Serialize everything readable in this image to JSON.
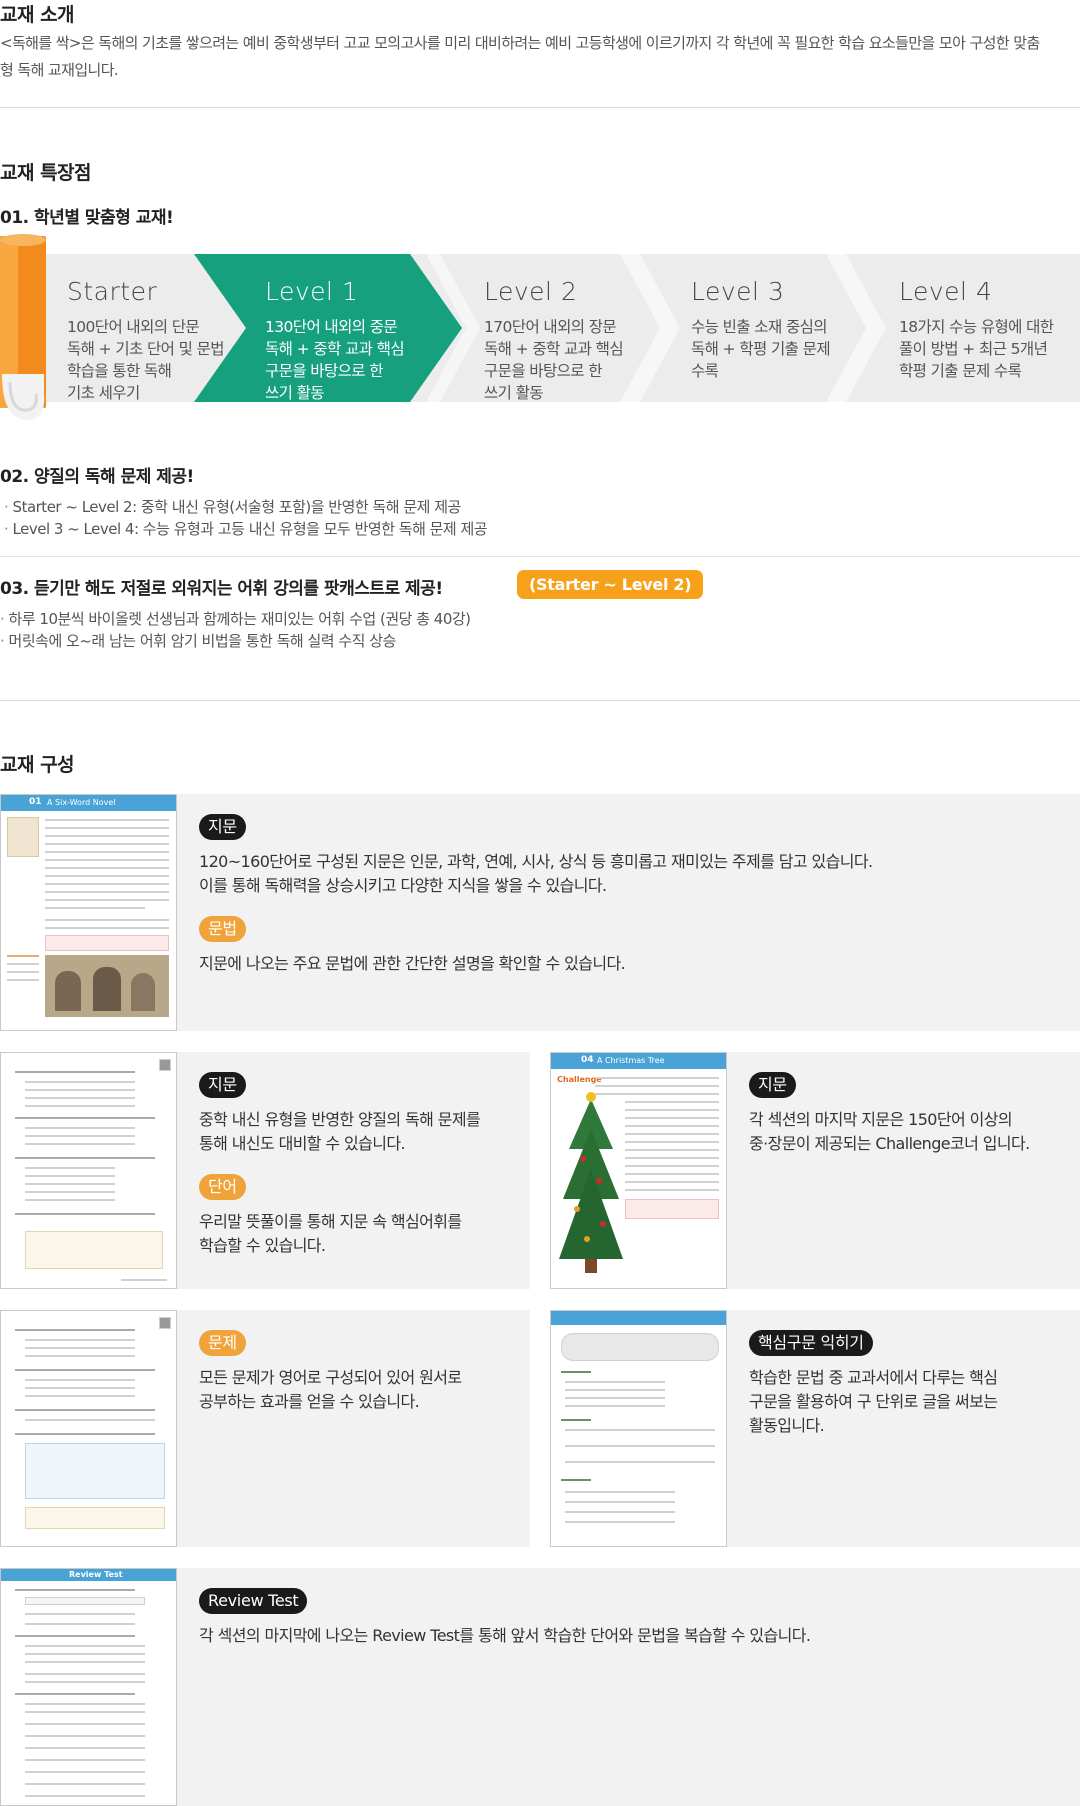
{
  "intro": {
    "title": "교재 소개",
    "body": "<독해를 싹>은 독해의 기초를 쌓으려는 예비 중학생부터 고교 모의고사를 미리 대비하려는 예비 고등학생에 이르기까지 각 학년에 꼭 필요한 학습 요소들만을 모아 구성한 맞춤형 독해 교재입니다."
  },
  "features": {
    "title": "교재 특장점",
    "f1": {
      "title": "01. 학년별 맞춤형 교재!",
      "levels": [
        {
          "name": "Starter",
          "desc": "100단어 내외의 단문\n독해 + 기초 단어 및 문법\n학습을 통한 독해\n기초 세우기"
        },
        {
          "name": "Level 1",
          "desc": "130단어 내외의 중문\n독해 + 중학 교과 핵심\n구문을 바탕으로 한\n쓰기 활동"
        },
        {
          "name": "Level 2",
          "desc": "170단어 내외의 장문\n독해 + 중학 교과 핵심\n구문을 바탕으로 한\n쓰기 활동"
        },
        {
          "name": "Level 3",
          "desc": "수능 빈출 소재 중심의\n독해 + 학평 기출 문제\n수록"
        },
        {
          "name": "Level 4",
          "desc": "18가지 수능 유형에 대한\n풀이 방법 + 최근 5개년\n학평 기출 문제 수록"
        }
      ]
    },
    "f2": {
      "title": "02. 양질의 독해 문제 제공!",
      "bullets": [
        "Starter ~ Level 2: 중학 내신 유형(서술형 포함)을 반영한 독해 문제 제공",
        "Level 3 ~ Level 4: 수능 유형과 고등 내신 유형을 모두 반영한 독해 문제 제공"
      ]
    },
    "f3": {
      "title": "03. 듣기만 해도 저절로 외워지는 어휘 강의를 팟캐스트로 제공!",
      "badge": "(Starter ~ Level 2)",
      "bullets": [
        "하루 10분씩 바이올렛 선생님과 함께하는 재미있는 어휘 수업 (권당 총 40강)",
        "머릿속에 오~래 남는 어휘 암기 비법을 통한 독해 실력 수직 상승"
      ]
    }
  },
  "composition": {
    "title": "교재 구성",
    "cards": [
      {
        "thumb_label": "A Six-Word Novel",
        "thumb_num": "01",
        "items": [
          {
            "tag": "지문",
            "text": "120~160단어로 구성된 지문은 인문, 과학, 연예, 시사, 상식 등 흥미롭고 재미있는 주제를 담고 있습니다.\n이를 통해 독해력을 상승시키고 다양한 지식을 쌓을 수 있습니다."
          },
          {
            "tag": "문법",
            "text": "지문에 나오는 주요 문법에 관한 간단한 설명을 확인할 수 있습니다."
          }
        ]
      },
      {
        "items": [
          {
            "tag": "지문",
            "text": "중학 내신 유형을 반영한 양질의 독해 문제를\n통해 내신도 대비할 수 있습니다."
          },
          {
            "tag": "단어",
            "text": "우리말 뜻풀이를 통해 지문 속 핵심어휘를\n학습할 수 있습니다."
          }
        ]
      },
      {
        "thumb_label": "A Christmas Tree",
        "thumb_num": "04",
        "thumb_tag": "Challenge",
        "items": [
          {
            "tag": "지문",
            "text": "각 섹션의 마지막 지문은 150단어 이상의\n중·장문이 제공되는 Challenge코너 입니다."
          }
        ]
      },
      {
        "items": [
          {
            "tag": "문제",
            "text": "모든 문제가 영어로 구성되어 있어 원서로\n공부하는 효과를 얻을 수 있습니다."
          }
        ]
      },
      {
        "items": [
          {
            "tag": "핵심구문 익히기",
            "text": "학습한 문법 중 교과서에서 다루는 핵심\n구문을 활용하여 구 단위로 글을 써보는\n활동입니다."
          }
        ]
      },
      {
        "thumb_label": "Review Test",
        "items": [
          {
            "tag": "Review Test",
            "text": "각 섹션의 마지막에 나오는 Review Test를 통해 앞서 학습한 단어와 문법을 복습할 수 있습니다."
          }
        ]
      }
    ]
  },
  "colors": {
    "accent_green": "#16a07e",
    "accent_orange": "#f7a11a",
    "band_gray": "#ececec",
    "card_gray": "#f2f2f2",
    "thumb_blue": "#4aa3d6"
  }
}
